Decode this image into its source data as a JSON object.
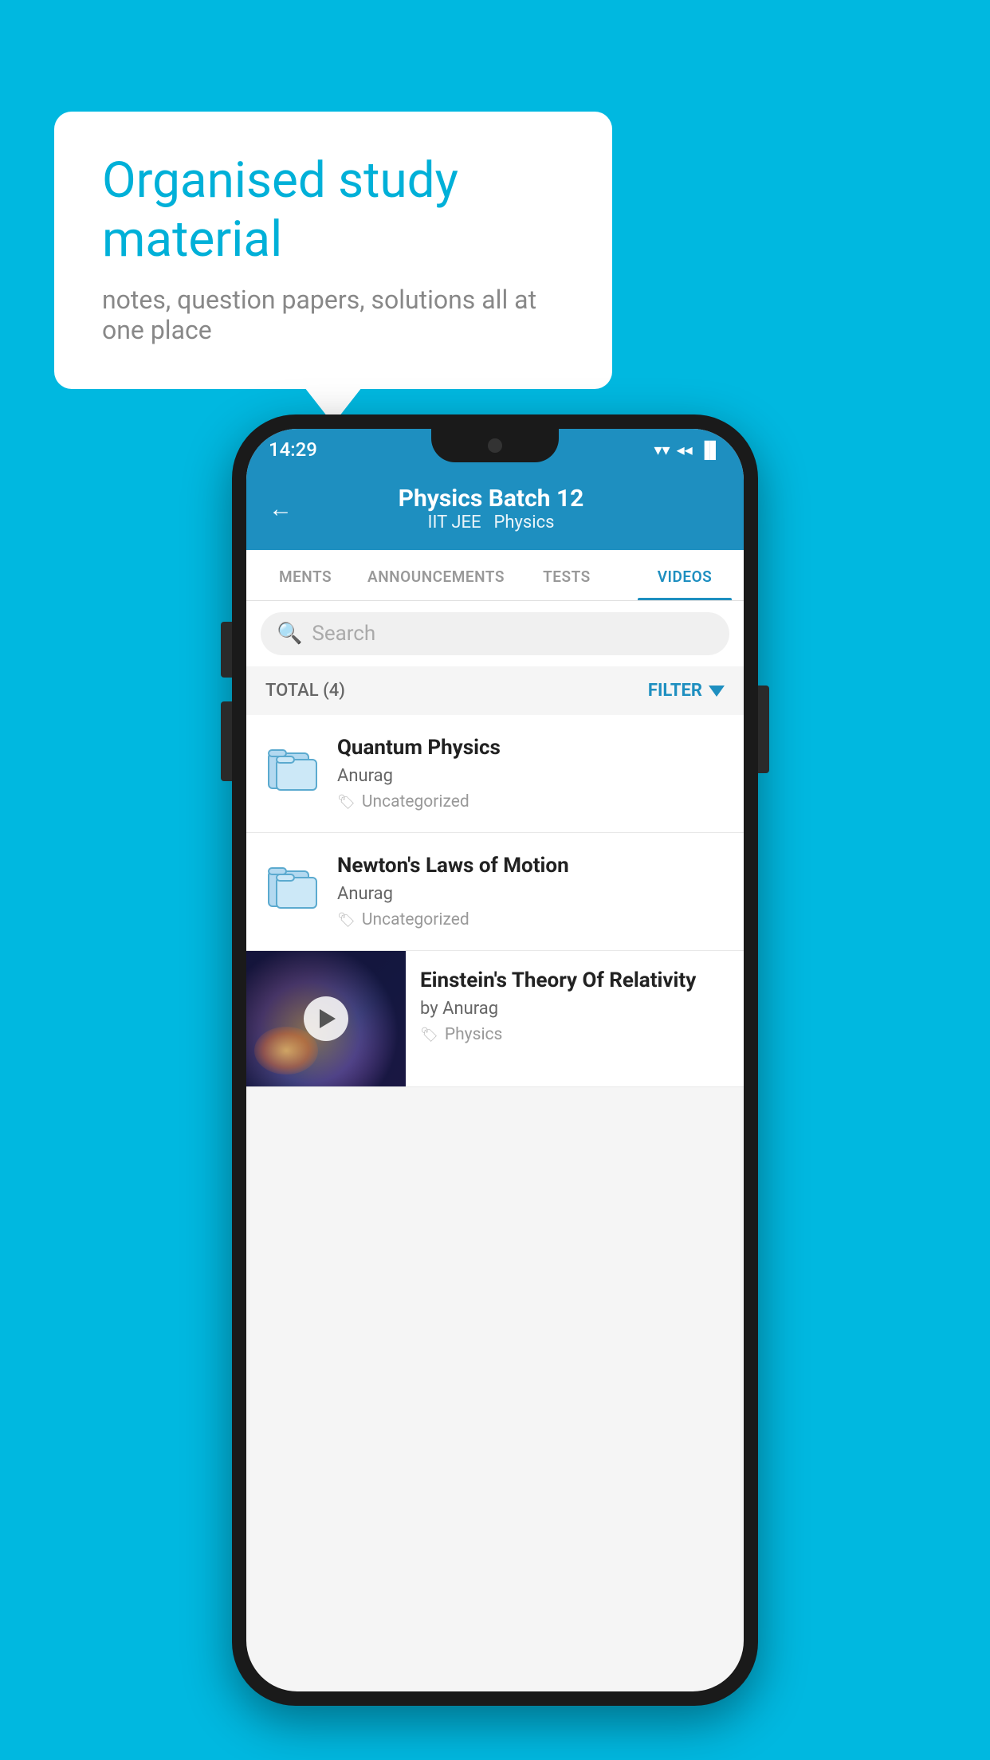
{
  "background_color": "#00b8e0",
  "speech_bubble": {
    "title": "Organised study material",
    "subtitle": "notes, question papers, solutions all at one place"
  },
  "status_bar": {
    "time": "14:29",
    "wifi": "▼",
    "signal": "▲",
    "battery": "▐"
  },
  "header": {
    "title": "Physics Batch 12",
    "subtitle1": "IIT JEE",
    "subtitle2": "Physics",
    "back_label": "←"
  },
  "tabs": [
    {
      "label": "MENTS",
      "active": false
    },
    {
      "label": "ANNOUNCEMENTS",
      "active": false
    },
    {
      "label": "TESTS",
      "active": false
    },
    {
      "label": "VIDEOS",
      "active": true
    }
  ],
  "search": {
    "placeholder": "Search"
  },
  "filter_bar": {
    "total_label": "TOTAL (4)",
    "filter_label": "FILTER"
  },
  "videos": [
    {
      "title": "Quantum Physics",
      "author": "Anurag",
      "tag": "Uncategorized",
      "has_thumb": false
    },
    {
      "title": "Newton's Laws of Motion",
      "author": "Anurag",
      "tag": "Uncategorized",
      "has_thumb": false
    },
    {
      "title": "Einstein's Theory Of Relativity",
      "author": "by Anurag",
      "tag": "Physics",
      "has_thumb": true
    }
  ]
}
